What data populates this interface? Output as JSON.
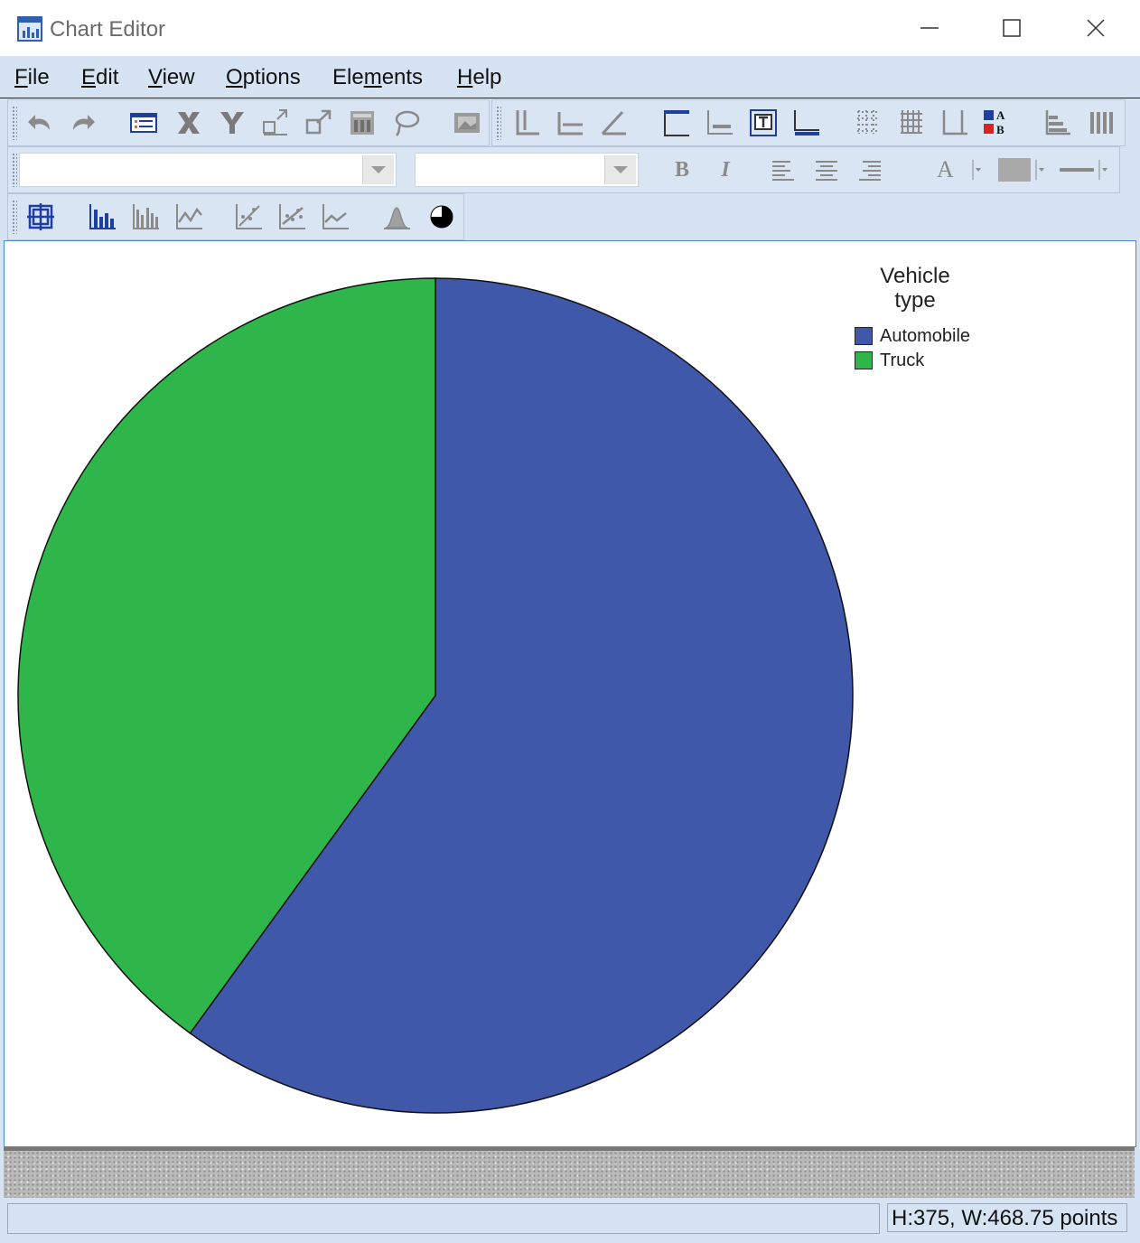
{
  "window": {
    "title": "Chart Editor"
  },
  "menu": [
    {
      "label": "File",
      "u": "F",
      "rest": "ile"
    },
    {
      "label": "Edit",
      "u": "E",
      "rest": "dit"
    },
    {
      "label": "View",
      "u": "V",
      "rest": "iew"
    },
    {
      "label": "Options",
      "u": "O",
      "rest": "ptions"
    },
    {
      "label": "Elements",
      "pre": "Ele",
      "u": "m",
      "rest": "ents"
    },
    {
      "label": "Help",
      "u": "H",
      "rest": "elp"
    }
  ],
  "format_toolbar": {
    "font_value": "",
    "size_value": "",
    "bold": "B",
    "italic": "I",
    "text_icon": "A"
  },
  "toolbar_icons": [
    "undo-icon",
    "redo-icon",
    "properties-icon",
    "x-axis-icon",
    "y-axis-icon",
    "rescale-icon",
    "expand-icon",
    "chart-icon",
    "lasso-icon",
    "image-icon",
    "y-axis-select-icon",
    "x-axis-select-icon",
    "z-axis-icon",
    "title-icon",
    "footnote-icon",
    "textbox-icon",
    "legend-icon",
    "gridlines-icon",
    "grid-icon",
    "reference-line-icon",
    "data-labels-icon",
    "bar-horizontal-icon",
    "bar-vertical-icon"
  ],
  "chart_toolbar_icons": [
    "select-chart-icon",
    "bar-chart-icon",
    "clustered-bar-icon",
    "line-chart-icon",
    "scatter-icon",
    "scatter-fit-icon",
    "area-chart-icon",
    "histogram-icon",
    "pie-chart-icon"
  ],
  "chart_data": {
    "type": "pie",
    "legend": {
      "title": "Vehicle type",
      "placement": "top-right"
    },
    "series": [
      {
        "name": "Automobile",
        "value": 60,
        "color": "#3f58a9"
      },
      {
        "name": "Truck",
        "value": 40,
        "color": "#2eb64a"
      }
    ],
    "start_angle_deg": 0,
    "direction": "clockwise"
  },
  "legend_title_lines": [
    "Vehicle",
    "type"
  ],
  "status": {
    "left": "",
    "right": "H:375, W:468.75 points"
  },
  "colors": {
    "accent": "#d6e3f2",
    "border": "#4a8ad4"
  }
}
